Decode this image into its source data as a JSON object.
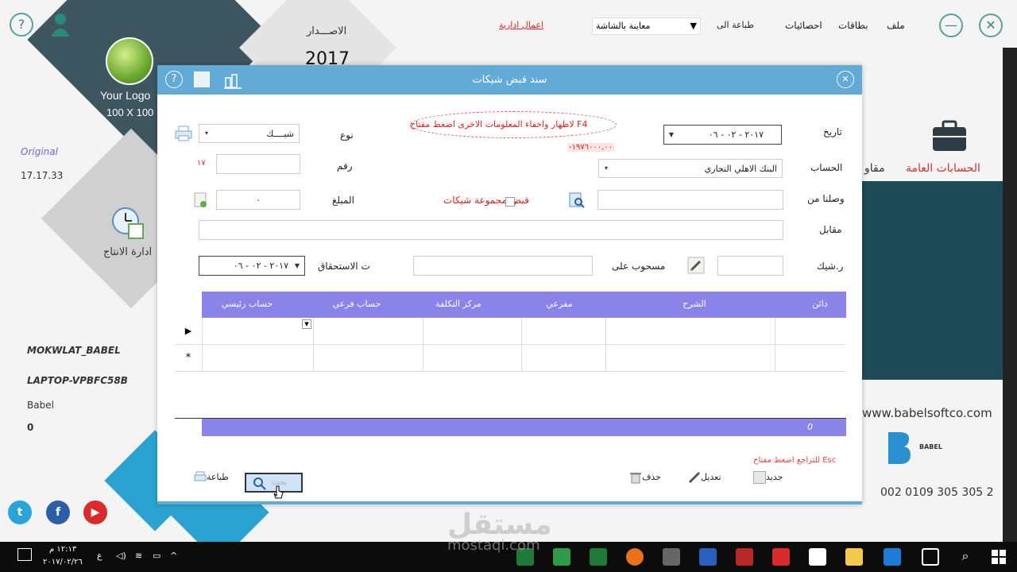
{
  "app": {
    "menu": {
      "file": "ملف",
      "cards": "بطاقات",
      "stats": "احصائيات",
      "print_to": "طباعة الى",
      "preview": "معاينة بالشاشة",
      "admin": "اعمال ادارية"
    },
    "version_label": "الاصـــدار",
    "version": "2017",
    "logo_line1": "Your Logo",
    "logo_line2": "100 X 100",
    "original": "Original",
    "build": "17.17.33",
    "production": "ادارة الانتاج",
    "general_accounts": "الحسابات العامة",
    "contracts": "مقاو",
    "db_name": "MOKWLAT_BABEL",
    "host": "LAPTOP-VPBFC58B",
    "user": "Babel",
    "zero": "0",
    "website": "www.babelsoftco.com",
    "phone": "002 0109 305 305 2",
    "babel_logo": "BABEL"
  },
  "dialog": {
    "title": "سند قبض شيكات",
    "hint_f4": "لاظهار واخفاء المعلومات الاخرى اضغط مفتاح F4",
    "balance": "-١٩٧٦٠٠٠,٠٠",
    "labels": {
      "date": "تاريخ",
      "account": "الحساب",
      "received_from": "وصلنا من",
      "against": "مقابل",
      "check_no": "ر.شيك",
      "drawn_on": "مسحوب على",
      "due_date": "ت الاستحقاق",
      "type": "نوع",
      "number": "رقم",
      "amount": "المبلغ",
      "multi_checks": "قبض مجموعة شيكات"
    },
    "values": {
      "date": "٢٠١٧ - ٠٢ - ٠٦",
      "account": "البنك الاهلي التجاري",
      "type": "شيــــك",
      "number_hint": "١٧",
      "amount": "٠",
      "due_date": "٢٠١٧ - ٠٢ - ٠٦"
    },
    "grid_headers": [
      "دائن",
      "الشرح",
      "مفرعي",
      "مركز التكلفة",
      "حساب فرعي",
      "حساب رئيسي"
    ],
    "total": "0",
    "esc_hint": "للتراجع اضغط مفتاح Esc",
    "buttons": {
      "new": "جديد",
      "edit": "تعديل",
      "delete": "حذف",
      "print": "طباعة",
      "search": "بحث"
    }
  },
  "taskbar": {
    "time": "١٢:١٣ م",
    "date": "٢٠١٧/٠٢/٢٦",
    "lang": "ع"
  },
  "watermark": "مستقل",
  "watermark_sub": "mostaql.com"
}
